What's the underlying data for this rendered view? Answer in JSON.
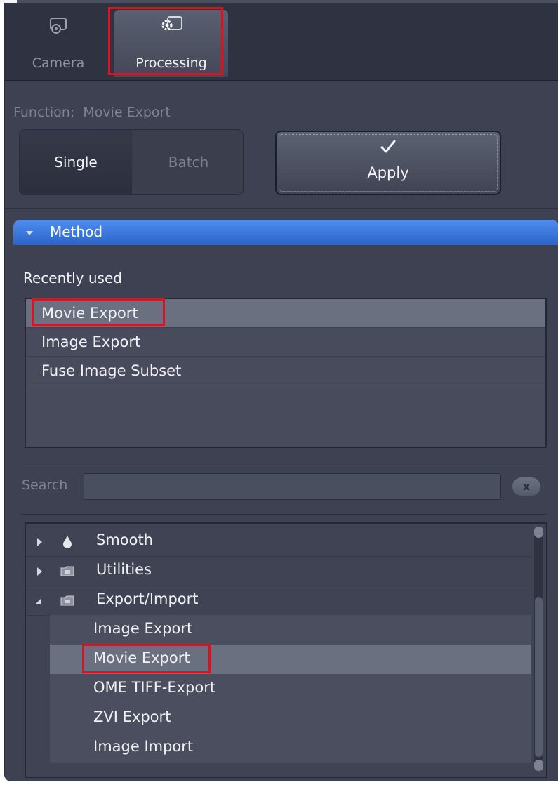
{
  "tabs": [
    {
      "label": "Camera",
      "icon": "camera-icon",
      "active": false
    },
    {
      "label": "Processing",
      "icon": "gear-icon",
      "active": true
    }
  ],
  "function": {
    "label": "Function:",
    "value": "Movie Export",
    "modes": [
      "Single",
      "Batch"
    ],
    "selected_mode": "Single",
    "apply_label": "Apply"
  },
  "method": {
    "title": "Method",
    "recent_label": "Recently used",
    "recent_items": [
      "Movie Export",
      "Image Export",
      "Fuse Image Subset"
    ],
    "recent_selected": "Movie Export"
  },
  "search": {
    "label": "Search",
    "value": "",
    "clear_label": "x"
  },
  "tree": {
    "categories": [
      {
        "label": "Smooth",
        "icon": "drop-icon",
        "expanded": false
      },
      {
        "label": "Utilities",
        "icon": "folder-icon",
        "expanded": false
      },
      {
        "label": "Export/Import",
        "icon": "folder-icon",
        "expanded": true
      }
    ],
    "children": [
      "Image Export",
      "Movie Export",
      "OME TIFF-Export",
      "ZVI Export",
      "Image Import"
    ],
    "selected_child": "Movie Export"
  },
  "colors": {
    "panel_bg": "#3d4151",
    "header_blue": "#3a78e0",
    "highlight_red": "#e3101b",
    "selection": "#6b7081"
  }
}
